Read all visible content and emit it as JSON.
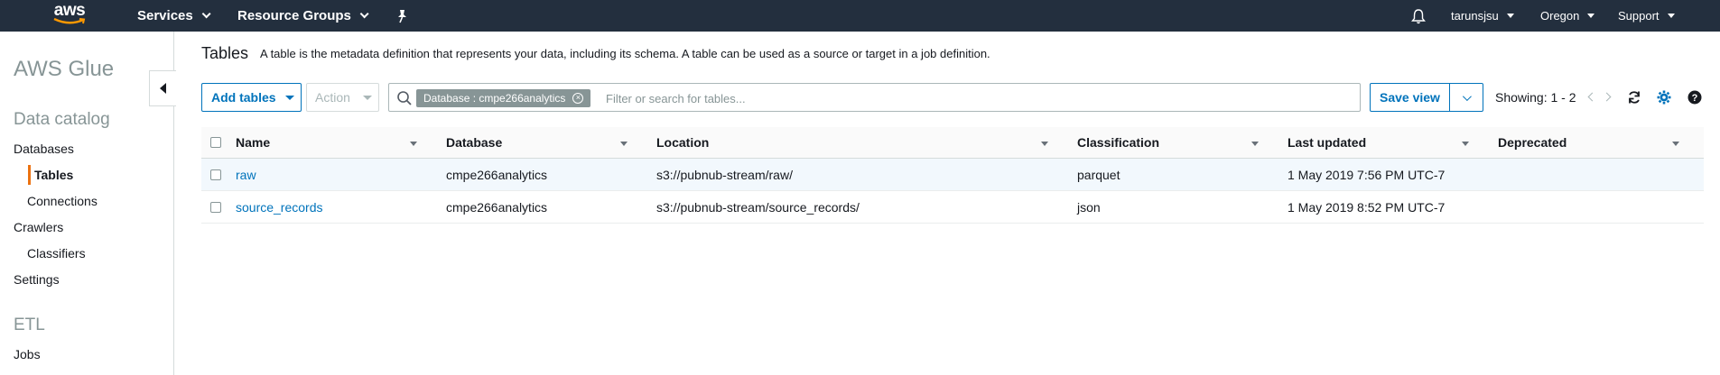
{
  "topnav": {
    "logo_text": "aws",
    "services": "Services",
    "resource_groups": "Resource Groups",
    "user": "tarunsjsu",
    "region": "Oregon",
    "support": "Support",
    "bg_color": "#232f3e"
  },
  "sidebar": {
    "title": "AWS Glue",
    "data_catalog": "Data catalog",
    "databases": "Databases",
    "tables": "Tables",
    "connections": "Connections",
    "crawlers": "Crawlers",
    "classifiers": "Classifiers",
    "settings": "Settings",
    "etl": "ETL",
    "jobs": "Jobs"
  },
  "main": {
    "heading": "Tables",
    "description": "A table is the metadata definition that represents your data, including its schema. A table can be used as a source or target in a job definition.",
    "add_tables": "Add tables",
    "action": "Action",
    "filter_token": "Database : cmpe266analytics",
    "search_placeholder": "Filter or search for tables...",
    "save_view": "Save view",
    "showing": "Showing: 1 - 2"
  },
  "table": {
    "columns": [
      "Name",
      "Database",
      "Location",
      "Classification",
      "Last updated",
      "Deprecated"
    ],
    "rows": [
      {
        "name": "raw",
        "database": "cmpe266analytics",
        "location": "s3://pubnub-stream/raw/",
        "classification": "parquet",
        "last_updated": "1 May 2019 7:56 PM UTC-7",
        "deprecated": ""
      },
      {
        "name": "source_records",
        "database": "cmpe266analytics",
        "location": "s3://pubnub-stream/source_records/",
        "classification": "json",
        "last_updated": "1 May 2019 8:52 PM UTC-7",
        "deprecated": ""
      }
    ]
  },
  "colors": {
    "accent": "#0073bb",
    "active_marker": "#ec7211",
    "settings_icon": "#0073bb"
  },
  "icons": {
    "bell": "bell-icon",
    "pin": "pin-icon",
    "search": "search-icon",
    "refresh": "refresh-icon",
    "settings": "gear-icon",
    "help": "help-icon"
  }
}
